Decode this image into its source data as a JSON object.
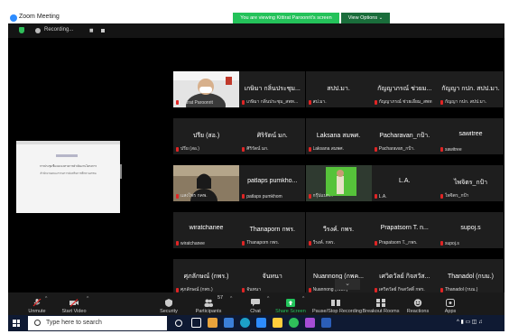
{
  "window": {
    "title": "Zoom Meeting",
    "banner": "You are viewing Kittirat Paroonrit's screen",
    "view_options": "View Options ⌄"
  },
  "recording": {
    "label": "Recording..."
  },
  "shared_screen": {
    "line1": "การประชุมชี้แจงแนวทางการดำเนินงานโครงการ",
    "line2": "สำนักงานคณะกรรมการส่งเสริมการศึกษาเอกชน"
  },
  "participants": [
    {
      "name": "",
      "label": "Kittirat Paroonrit",
      "video": "person-mask"
    },
    {
      "name": "เกษิมา กลิ่นประชุม...",
      "label": "เกษิมา กลิ่นประชุม_สพท..."
    },
    {
      "name": "สปป.มา.",
      "label": "สป.มา."
    },
    {
      "name": "กัญญาภรณ์ ช่วยม...",
      "label": "กัญญาภรณ์ ช่วยเอี่ยม_สพท"
    },
    {
      "name": "กัญญา กปก. สปป.มา.",
      "label": "กัญญา กปก. สปป.มา."
    },
    {
      "name": "ปรีย (สอ.)",
      "label": "ปรีย (สอ.)"
    },
    {
      "name": "ศิริรัตน์ มก.",
      "label": "ศิริรัตน์ มก."
    },
    {
      "name": "Laksana สมพศ.",
      "label": "Laksana สมพศ."
    },
    {
      "name": "Pacharavan_กป้า.",
      "label": "Pacharavan_กป้า."
    },
    {
      "name": "sawitree",
      "label": "sawitree"
    },
    {
      "name": "",
      "label": "แสงไพร กคพ.",
      "video": "person-room"
    },
    {
      "name": "patlaps pumkho...",
      "label": "patlaps pumkhom"
    },
    {
      "name": "",
      "label": "กรุ๊ปแบก...",
      "video": "green-screen"
    },
    {
      "name": "L.A.",
      "label": "L.A."
    },
    {
      "name": "ไพจิตร_กป้า",
      "label": "ไพจิตร_กป้า"
    },
    {
      "name": "wiratchanee",
      "label": "wiratchanee"
    },
    {
      "name": "Thanaporn กพร.",
      "label": "Thanaporn กพร."
    },
    {
      "name": "วีรงค์. กพร.",
      "label": "วีรงค์. กพร."
    },
    {
      "name": "Prapatsorn T. n...",
      "label": "Prapatsorn T._กพร."
    },
    {
      "name": "supoj.s",
      "label": "supoj.s"
    },
    {
      "name": "ศุภลักษณ์ (กพร.)",
      "label": "ศุภลักษณ์ (กพร.)"
    },
    {
      "name": "จันทนา",
      "label": "จันทนา"
    },
    {
      "name": "Nuannong (กพค...",
      "label": "Nuannong (กพค.)"
    },
    {
      "name": "เศวิตวัลย์ กิจสวัส...",
      "label": "เศวิตวัลย์ กิจสวัสดิ์ กพร."
    },
    {
      "name": "Thanadol (กบม.)",
      "label": "Thanadol (กบม.)"
    }
  ],
  "toolbar": {
    "unmute": "Unmute",
    "start_video": "Start Video",
    "security": "Security",
    "participants": "Participants",
    "participants_count": "57",
    "chat": "Chat",
    "share_screen": "Share Screen",
    "pause_recording": "Pause/Stop Recording",
    "breakout_rooms": "Breakout Rooms",
    "reactions": "Reactions",
    "apps": "Apps"
  },
  "taskbar": {
    "search_placeholder": "Type here to search",
    "tray": "^ ▮ ▭ ◫ ♫"
  },
  "colors": {
    "accent_green": "#24c25a",
    "tile_bg": "#1e1e1e",
    "muted_red": "#e02525",
    "taskbar_bg": "#0f1a33"
  }
}
